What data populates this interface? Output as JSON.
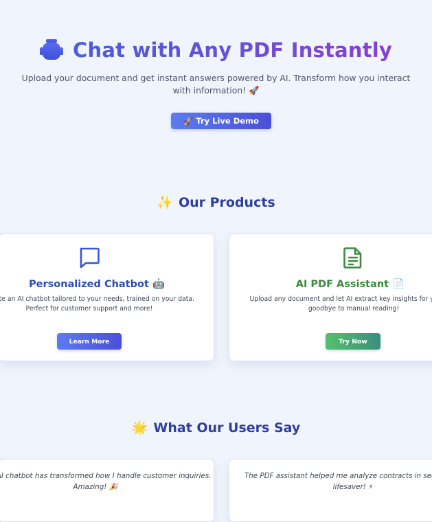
{
  "hero": {
    "title": "Chat with Any PDF Instantly",
    "robot_icon": "robot-icon",
    "subtitle": "Upload your document and get instant answers powered by AI. Transform how you interact with information! 🚀",
    "demo_button": "🚀 Try Live Demo"
  },
  "products": {
    "heading_emoji": "✨",
    "heading": "Our Products",
    "cards": [
      {
        "icon": "chat-bubble-icon",
        "title": "Personalized Chatbot 🤖",
        "description": "Create an AI chatbot tailored to your needs, trained on your data. Perfect for customer support and more!",
        "button": "Learn More",
        "accent": "#2d4db0"
      },
      {
        "icon": "document-icon",
        "title": "AI PDF Assistant 📄",
        "description": "Upload any document and let AI extract key insights for you. Say goodbye to manual reading!",
        "button": "Try Now",
        "accent": "#3b8a3f"
      }
    ]
  },
  "testimonials": {
    "heading_emoji": "🌟",
    "heading": "What Our Users Say",
    "quotes": [
      "This AI chatbot has transformed how I handle customer inquiries. Amazing! 🎉",
      "The PDF assistant helped me analyze contracts in seconds. A lifesaver! ⚡"
    ]
  },
  "colors": {
    "background": "#f0f4fc",
    "heading": "#2d3e9c",
    "primary_gradient_start": "#5b7cf0",
    "primary_gradient_end": "#4b4fd8",
    "green_gradient_start": "#55c06c",
    "green_gradient_end": "#3a8e80"
  }
}
